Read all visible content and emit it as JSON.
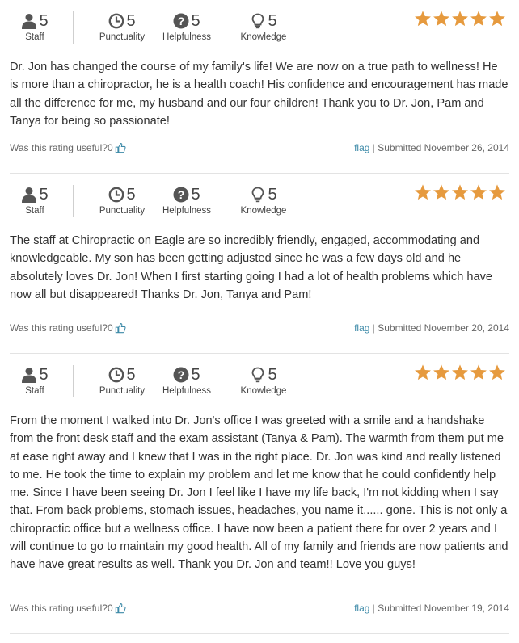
{
  "colors": {
    "star": "#e69a3e",
    "link": "#3d8aa8",
    "icon": "#555555",
    "thumb": "#3d8aa8"
  },
  "reviews": [
    {
      "ratings": {
        "staff": "5",
        "punctuality": "5",
        "helpfulness": "5",
        "knowledge": "5"
      },
      "stars": 5,
      "text": "Dr. Jon has changed the course of my family's life! We are now on a true path to wellness! He is more than a chiropractor, he is a health coach! His confidence and encouragement has made all the difference for me, my husband and our four children! Thank you to Dr. Jon, Pam and Tanya for being so passionate!",
      "useful_count": "0",
      "submitted": "Submitted November 26, 2014"
    },
    {
      "ratings": {
        "staff": "5",
        "punctuality": "5",
        "helpfulness": "5",
        "knowledge": "5"
      },
      "stars": 5,
      "text": "The staff at Chiropractic on Eagle are so incredibly friendly, engaged, accommodating and knowledgeable. My son has been getting adjusted since he was a few days old and he absolutely loves Dr. Jon! When I first starting going I had a lot of health problems which have now all but disappeared! Thanks Dr. Jon, Tanya and Pam!",
      "useful_count": "0",
      "submitted": "Submitted November 20, 2014"
    },
    {
      "ratings": {
        "staff": "5",
        "punctuality": "5",
        "helpfulness": "5",
        "knowledge": "5"
      },
      "stars": 5,
      "text": "From the moment I walked into Dr. Jon's office I was greeted with a smile and a handshake from the front desk staff and the exam assistant (Tanya & Pam). The warmth from them put me at ease right away and I knew that I was in the right place. Dr. Jon was kind and really listened to me. He took the time to explain my problem and let me know that he could confidently help me. Since I have been seeing Dr. Jon I feel like I have my life back, I'm not kidding when I say that. From back problems, stomach issues, headaches, you name it...... gone. This is not only a chiropractic office but a wellness office. I have now been a patient there for over 2 years and I will continue to go to maintain my good health. All of my family and friends are now patients and have have great results as well. Thank you Dr. Jon and team!! Love you guys!",
      "useful_count": "0",
      "submitted": "Submitted November 19, 2014"
    }
  ],
  "labels": {
    "staff": "Staff",
    "punctuality": "Punctuality",
    "helpfulness": "Helpfulness",
    "knowledge": "Knowledge",
    "useful": "Was this rating useful?",
    "flag": "flag",
    "separator": "|"
  }
}
